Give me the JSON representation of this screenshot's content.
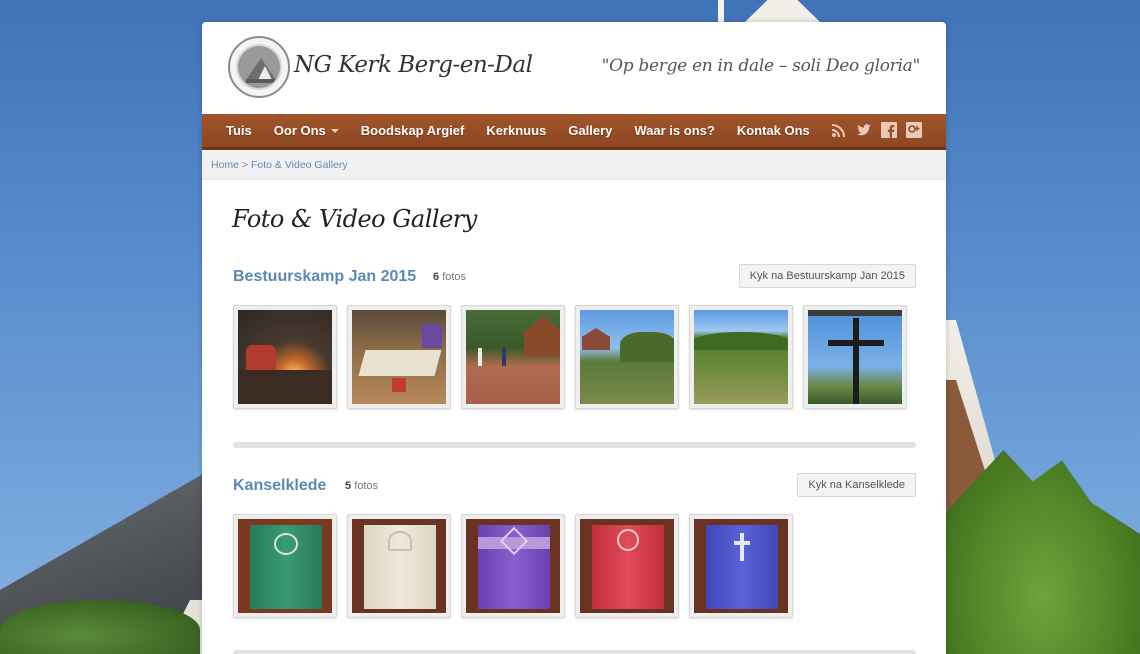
{
  "site": {
    "title": "NG Kerk Berg-en-Dal",
    "tagline": "\"Op berge en in dale – soli Deo gloria\""
  },
  "nav": {
    "items": [
      {
        "label": "Tuis"
      },
      {
        "label": "Oor Ons",
        "dropdown": true
      },
      {
        "label": "Boodskap Argief"
      },
      {
        "label": "Kerknuus"
      },
      {
        "label": "Gallery"
      },
      {
        "label": "Waar is ons?"
      },
      {
        "label": "Kontak Ons"
      }
    ],
    "social_icons": [
      "rss-icon",
      "twitter-icon",
      "facebook-icon",
      "google-plus-icon"
    ]
  },
  "breadcrumb": {
    "home": "Home",
    "separator": " > ",
    "current": "Foto & Video Gallery"
  },
  "page": {
    "title": "Foto & Video Gallery"
  },
  "albums": [
    {
      "title": "Bestuurskamp Jan 2015",
      "count": "6",
      "count_unit": "fotos",
      "button": "Kyk na Bestuurskamp Jan 2015",
      "photos": [
        "campfire-night",
        "meeting-room",
        "group-outdoors",
        "landscape-bush",
        "valley-view",
        "cross-window"
      ]
    },
    {
      "title": "Kanselklede",
      "count": "5",
      "count_unit": "fotos",
      "button": "Kyk na Kanselklede",
      "photos": [
        "green-cloth",
        "white-cloth",
        "purple-cloth",
        "red-cloth",
        "blue-cloth"
      ]
    }
  ],
  "colors": {
    "nav_bg": "#9a4f27",
    "link": "#5c88b6",
    "cloth_green": "#2f8f6a",
    "cloth_white": "#e9e3d6",
    "cloth_purple": "#7a4bb8",
    "cloth_red": "#d23a4a",
    "cloth_blue": "#4b55c8"
  }
}
